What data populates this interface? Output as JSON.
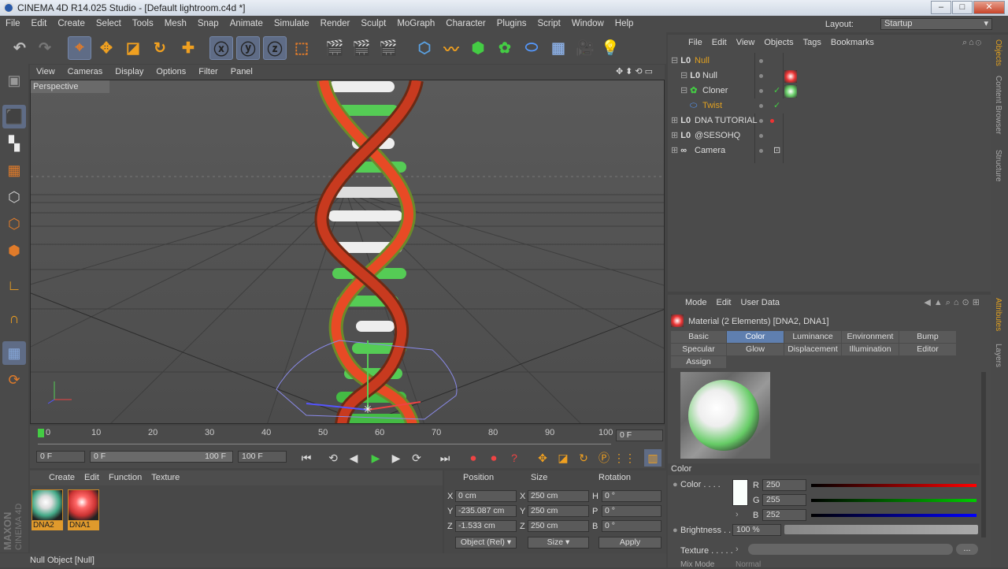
{
  "window": {
    "title": "CINEMA 4D R14.025 Studio - [Default lightroom.c4d *]",
    "min": "–",
    "max": "□",
    "close": "✕"
  },
  "menu": [
    "File",
    "Edit",
    "Create",
    "Select",
    "Tools",
    "Mesh",
    "Snap",
    "Animate",
    "Simulate",
    "Render",
    "Sculpt",
    "MoGraph",
    "Character",
    "Plugins",
    "Script",
    "Window",
    "Help"
  ],
  "layout": {
    "label": "Layout:",
    "value": "Startup"
  },
  "viewport": {
    "menu": [
      "View",
      "Cameras",
      "Display",
      "Options",
      "Filter",
      "Panel"
    ],
    "label": "Perspective"
  },
  "timeline": {
    "ticks": [
      "0",
      "10",
      "20",
      "30",
      "40",
      "50",
      "60",
      "70",
      "80",
      "90",
      "100"
    ],
    "frame_field": "0 F"
  },
  "transport": {
    "start": "0 F",
    "range_start": "0 F",
    "range_end": "100 F",
    "end": "100 F"
  },
  "material_manager": {
    "menu": [
      "Create",
      "Edit",
      "Function",
      "Texture"
    ],
    "materials": [
      {
        "name": "DNA2"
      },
      {
        "name": "DNA1"
      }
    ]
  },
  "coordinates": {
    "headers": [
      "Position",
      "Size",
      "Rotation"
    ],
    "rows": [
      {
        "axis": "X",
        "pos": "0 cm",
        "saxis": "X",
        "size": "250 cm",
        "raxis": "H",
        "rot": "0 °"
      },
      {
        "axis": "Y",
        "pos": "-235.087 cm",
        "saxis": "Y",
        "size": "250 cm",
        "raxis": "P",
        "rot": "0 °"
      },
      {
        "axis": "Z",
        "pos": "-1.533 cm",
        "saxis": "Z",
        "size": "250 cm",
        "raxis": "B",
        "rot": "0 °"
      }
    ],
    "mode": "Object (Rel)",
    "size_mode": "Size",
    "apply": "Apply"
  },
  "status": "Null Object [Null]",
  "branding": {
    "maxon": "MAXON",
    "cinema": "CINEMA 4D"
  },
  "object_manager": {
    "menu": [
      "File",
      "Edit",
      "View",
      "Objects",
      "Tags",
      "Bookmarks"
    ],
    "objects": [
      {
        "name": "Null"
      },
      {
        "name": "Null"
      },
      {
        "name": "Cloner"
      },
      {
        "name": "Twist"
      },
      {
        "name": "DNA TUTORIAL"
      },
      {
        "name": "@SESOHQ"
      },
      {
        "name": "Camera"
      }
    ]
  },
  "side_tabs": [
    "Objects",
    "Content Browser",
    "Structure",
    "Attributes",
    "Layers"
  ],
  "attributes": {
    "menu": [
      "Mode",
      "Edit",
      "User Data"
    ],
    "title": "Material (2 Elements) [DNA2, DNA1]",
    "tabs": [
      "Basic",
      "Color",
      "Luminance",
      "Environment",
      "Bump",
      "Specular",
      "Glow",
      "Displacement",
      "Illumination",
      "Editor",
      "Assign"
    ],
    "section": "Color",
    "color_label": "Color . . . .",
    "r_label": "R",
    "r": "250",
    "g_label": "G",
    "g": "255",
    "b_label": "B",
    "b": "252",
    "brightness_label": "Brightness . .",
    "brightness": "100 %",
    "texture_label": "Texture . . . . .",
    "mix_label": "Mix Mode",
    "mix_value": "Normal"
  }
}
